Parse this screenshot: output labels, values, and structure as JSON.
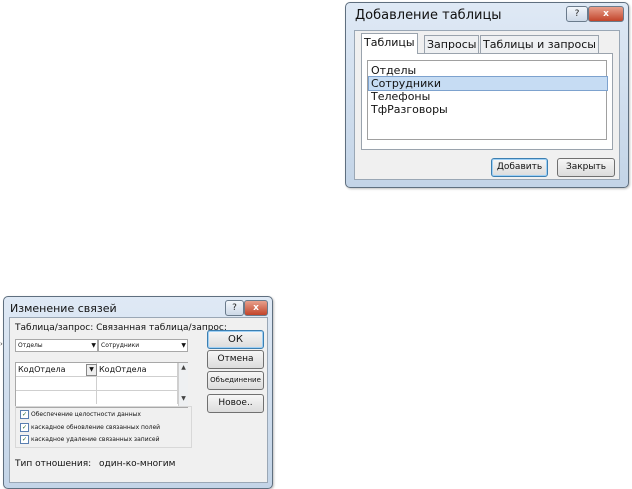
{
  "add_table_dialog": {
    "title": "Добавление таблицы",
    "help_glyph": "?",
    "close_glyph": "x",
    "tabs": [
      "Таблицы",
      "Запросы",
      "Таблицы и запросы"
    ],
    "active_tab": 0,
    "tables": [
      "Отделы",
      "Сотрудники",
      "Телефоны",
      "ТфРазговоры"
    ],
    "selected_index": 1,
    "add_button": "Добавить",
    "close_button": "Закрыть"
  },
  "edit_relations_dialog": {
    "title": "Изменение связей",
    "help_glyph": "?",
    "close_glyph": "x",
    "header_label": "Таблица/запрос: Связанная таблица/запрос:",
    "left_combo": "Отделы",
    "right_combo": "Сотрудники",
    "combo_arrow": "▼",
    "field_left": "КодОтдела",
    "field_right": "КодОтдела",
    "scroll_up": "▲",
    "scroll_down": "▼",
    "checkboxes": [
      {
        "label": "Обеспечение целостности данных",
        "checked": true
      },
      {
        "label": "каскадное обновление связанных полей",
        "checked": true
      },
      {
        "label": "каскадное удаление связанных записей",
        "checked": true
      }
    ],
    "check_glyph": "✓",
    "relation_type_label": "Тип отношения:",
    "relation_type_value": "один-ко-многим",
    "buttons": {
      "ok": "ОК",
      "cancel": "Отмена",
      "join": "Объединение",
      "new": "Новое.."
    }
  },
  "side_mark": "›"
}
